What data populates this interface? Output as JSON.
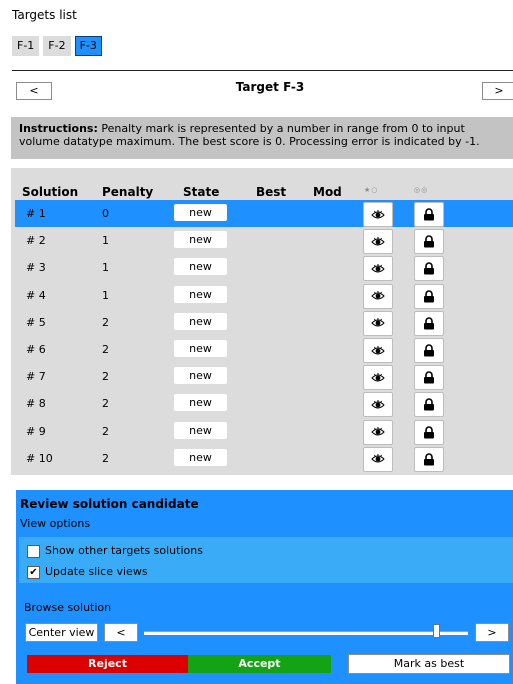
{
  "header": {
    "title": "Targets list"
  },
  "tabs": [
    {
      "label": "F-1",
      "active": false
    },
    {
      "label": "F-2",
      "active": false
    },
    {
      "label": "F-3",
      "active": true
    }
  ],
  "target_nav": {
    "prev": "<",
    "title": "Target F-3",
    "next": ">"
  },
  "instructions": {
    "bold": "Instructions:",
    "text": " Penalty mark is represented by a number in range from 0 to input volume datatype maximum. The best score is 0. Processing error is indicated by -1."
  },
  "table": {
    "columns": [
      "Solution",
      "Penalty",
      "State",
      "Best",
      "Mod"
    ],
    "tiny_icons": [
      "★○",
      "◎◎"
    ],
    "rows": [
      {
        "solution": "# 1",
        "penalty": "0",
        "state": "new"
      },
      {
        "solution": "# 2",
        "penalty": "1",
        "state": "new"
      },
      {
        "solution": "# 3",
        "penalty": "1",
        "state": "new"
      },
      {
        "solution": "# 4",
        "penalty": "1",
        "state": "new"
      },
      {
        "solution": "# 5",
        "penalty": "2",
        "state": "new"
      },
      {
        "solution": "# 6",
        "penalty": "2",
        "state": "new"
      },
      {
        "solution": "# 7",
        "penalty": "2",
        "state": "new"
      },
      {
        "solution": "# 8",
        "penalty": "2",
        "state": "new"
      },
      {
        "solution": "# 9",
        "penalty": "2",
        "state": "new"
      },
      {
        "solution": "# 10",
        "penalty": "2",
        "state": "new"
      }
    ],
    "selected_row": 0
  },
  "review": {
    "title": "Review solution candidate",
    "view_options": "View options",
    "show_other": {
      "label": "Show other targets solutions",
      "checked": false
    },
    "update_slice": {
      "label": "Update slice views",
      "checked": true
    },
    "browse_solution": "Browse solution",
    "center_view": "Center view",
    "prev": "<",
    "next": ">",
    "slider_position": 0.9,
    "reject": "Reject",
    "accept": "Accept",
    "mark_best": "Mark as best"
  },
  "colors": {
    "accent": "#1e90ff",
    "reject": "#dd0000",
    "accept": "#15a316"
  }
}
